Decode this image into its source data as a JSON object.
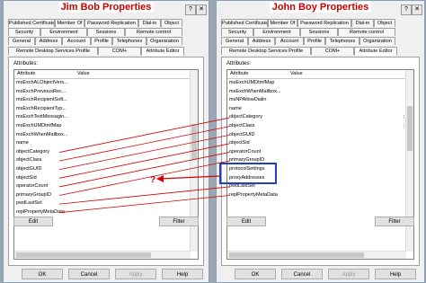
{
  "left": {
    "title": "Jim Bob Properties",
    "tabs_row1": [
      "Published Certificates",
      "Member Of",
      "Password Replication",
      "Dial-in",
      "Object"
    ],
    "tabs_row2": [
      "Security",
      "Environment",
      "Sessions",
      "Remote control"
    ],
    "tabs_row3": [
      "General",
      "Address",
      "Account",
      "Profile",
      "Telephones",
      "Organization"
    ],
    "tabs_row4": [
      "Remote Desktop Services Profile",
      "COM+",
      "Attribute Editor"
    ],
    "attributes_label": "Attributes:",
    "col_attribute": "Attribute",
    "col_value": "Value",
    "rows": [
      "msExchALObjectVers...",
      "msExchPreviousRec...",
      "msExchRecipientSoft...",
      "msExchRecipientTyp...",
      "msExchTextMessagin...",
      "msExchUMDtmfMap",
      "msExchWhenMailbox...",
      "name",
      "objectCategory",
      "objectClass",
      "objectGUID",
      "objectSid",
      "operatorCount",
      "primaryGroupID",
      "pwdLastSet",
      "replPropertyMetaData"
    ],
    "edit_label": "Edit",
    "filter_label": "Filter",
    "ok_label": "OK",
    "cancel_label": "Cancel",
    "apply_label": "Apply",
    "help_label": "Help"
  },
  "right": {
    "title": "John Boy Properties",
    "tabs_row1": [
      "Published Certificates",
      "Member Of",
      "Password Replication",
      "Dial-in",
      "Object"
    ],
    "tabs_row2": [
      "Security",
      "Environment",
      "Sessions",
      "Remote control"
    ],
    "tabs_row3": [
      "General",
      "Address",
      "Account",
      "Profile",
      "Telephones",
      "Organization"
    ],
    "tabs_row4": [
      "Remote Desktop Services Profile",
      "COM+",
      "Attribute Editor"
    ],
    "attributes_label": "Attributes:",
    "col_attribute": "Attribute",
    "col_value": "Value",
    "rows": [
      "msExchUMDtmfMap",
      "msExchWhenMailbox...",
      "msNPAllowDialin",
      "name",
      "objectCategory",
      "objectClass",
      "objectGUID",
      "objectSid",
      "operatorCount",
      "primaryGroupID",
      "protocolSettings",
      "proxyAddresses",
      "pwdLastSet",
      "replPropertyMetaData"
    ],
    "value_glyph": ";",
    "edit_label": "Edit",
    "filter_label": "Filter",
    "ok_label": "OK",
    "cancel_label": "Cancel",
    "apply_label": "Apply",
    "help_label": "Help"
  },
  "annotation": {
    "question_mark": "?",
    "line_color": "#d40000",
    "box_color": "#1f3fbf"
  }
}
